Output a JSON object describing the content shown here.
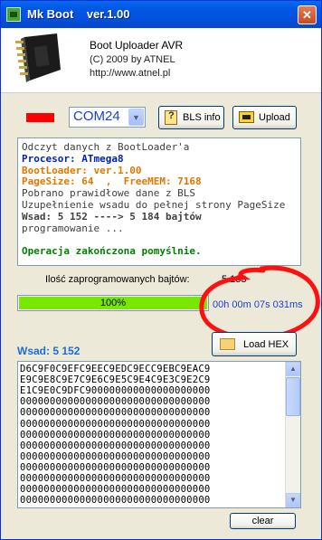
{
  "window": {
    "title": "Mk Boot    ver.1.00",
    "close_glyph": "✕"
  },
  "header": {
    "product": "Boot Uploader AVR",
    "copyright": "(C) 2009 by ATNEL",
    "url": "http://www.atnel.pl",
    "chip_icon": "chip-icon"
  },
  "port": {
    "value": "COM24",
    "status_color": "#ff0000"
  },
  "buttons": {
    "bls_info": "BLS info",
    "upload": "Upload",
    "load_hex": "Load HEX",
    "clear": "clear"
  },
  "log": [
    {
      "text": "Odczyt danych z BootLoader'a",
      "color": "#404040",
      "bold": false
    },
    {
      "text": "Procesor: ATmega8",
      "color": "#0020c0",
      "bold": true
    },
    {
      "text": "BootLoader: ver.1.00",
      "color": "#e07800",
      "bold": true
    },
    {
      "text": "PageSize: 64  ,  FreeMEM: 7168",
      "color": "#e07800",
      "bold": true
    },
    {
      "text": "Pobrano prawidłowe dane z BLS",
      "color": "#404040",
      "bold": false
    },
    {
      "text": "Uzupełnienie wsadu do pełnej strony PageSize",
      "color": "#404040",
      "bold": false
    },
    {
      "text": "Wsad: 5 152 ----> 5 184 bajtów",
      "color": "#404040",
      "bold": true
    },
    {
      "text": "programowanie ...",
      "color": "#404040",
      "bold": false
    },
    {
      "text": "",
      "color": "#404040",
      "bold": false
    },
    {
      "text": "Operacja zakończona pomyślnie.",
      "color": "#008000",
      "bold": true
    }
  ],
  "programmed": {
    "label": "Ilość zaprogramowanych bajtów:",
    "value": "5 183"
  },
  "progress": {
    "percent": 100,
    "label": "100%",
    "fill_color": "#79e800"
  },
  "timer": "00h 00m 07s 031ms",
  "annotation_color": "#ff1010",
  "wsad": {
    "label": "Wsad: 5 152"
  },
  "hex_lines": [
    "D6C9F0C9EFC9EEC9EDC9ECC9EBC9EAC9",
    "E9C9E8C9E7C9E6C9E5C9E4C9E3C9E2C9",
    "E1C9E0C9DFC900000000000000000000",
    "00000000000000000000000000000000",
    "00000000000000000000000000000000",
    "00000000000000000000000000000000",
    "00000000000000000000000000000000",
    "00000000000000000000000000000000",
    "00000000000000000000000000000000",
    "00000000000000000000000000000000",
    "00000000000000000000000000000000",
    "00000000000000000000000000000000",
    "00000000000000000000000000000000"
  ],
  "scrollbar": {
    "up_glyph": "▲",
    "down_glyph": "▼"
  }
}
